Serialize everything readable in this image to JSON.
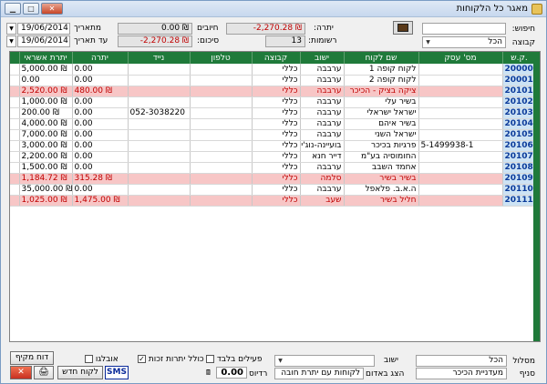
{
  "window": {
    "title": "מאגר כל הלקוחות",
    "minimize": "▁",
    "maximize": "□",
    "close": "✕"
  },
  "filters": {
    "search_label": "חיפוש:",
    "search_value": "",
    "group_label": "קבוצה",
    "group_value": "הכל",
    "balance_label": "יתרה:",
    "balance_value": "-2,270.28 ₪",
    "records_label": "רשומות:",
    "records_value": "13",
    "debits_label": "חיובים",
    "debits_value": "0.00 ₪",
    "total_label": "סיכום:",
    "total_value": "-2,270.28 ₪",
    "from_date_label": "מתאריך",
    "from_date_value": "19/06/2014",
    "to_date_label": "עד תאריך",
    "to_date_value": "19/06/2014"
  },
  "table": {
    "columns": [
      "ק.ש.",
      "מס' עסק",
      "שם לקוח",
      "ישוב",
      "קבוצה",
      "טלפון",
      "נייד",
      "יתרה",
      "יתרת אשראי"
    ],
    "rows": [
      {
        "code": "20000",
        "biz": "",
        "name": "לקוח קופה 1",
        "city": "ערבבה",
        "group": "כללי",
        "phone": "",
        "mobile": "",
        "balance": "0.00",
        "credit": "5,000.00 ₪",
        "debt": false
      },
      {
        "code": "20001",
        "biz": "",
        "name": "לקוח קופה 2",
        "city": "ערבבה",
        "group": "כללי",
        "phone": "",
        "mobile": "",
        "balance": "0.00",
        "credit": "0.00",
        "debt": false
      },
      {
        "code": "20101",
        "biz": "",
        "name": "ציקה בציק - הכיכר",
        "city": "ערבבה",
        "group": "כללי",
        "phone": "",
        "mobile": "",
        "balance": "480.00 ₪",
        "credit": "2,520.00 ₪",
        "debt": true
      },
      {
        "code": "20102",
        "biz": "",
        "name": "בשיר עלי",
        "city": "ערבבה",
        "group": "כללי",
        "phone": "",
        "mobile": "",
        "balance": "0.00",
        "credit": "1,000.00 ₪",
        "debt": false
      },
      {
        "code": "20103",
        "biz": "",
        "name": "ישראל ישראלי",
        "city": "ערבבה",
        "group": "כללי",
        "phone": "",
        "mobile": "052-3038220",
        "balance": "0.00",
        "credit": "200.00 ₪",
        "debt": false
      },
      {
        "code": "20104",
        "biz": "",
        "name": "בשיר איהם",
        "city": "ערבבה",
        "group": "כללי",
        "phone": "",
        "mobile": "",
        "balance": "0.00",
        "credit": "4,000.00 ₪",
        "debt": false
      },
      {
        "code": "20105",
        "biz": "",
        "name": "ישראל השני",
        "city": "ערבבה",
        "group": "כללי",
        "phone": "",
        "mobile": "",
        "balance": "0.00",
        "credit": "7,000.00 ₪",
        "debt": false
      },
      {
        "code": "20106",
        "biz": "5-1499938-1",
        "name": "פרגיות בכיכר",
        "city": "בועיינה-נוג'יד",
        "group": "כללי",
        "phone": "",
        "mobile": "",
        "balance": "0.00",
        "credit": "3,000.00 ₪",
        "debt": false
      },
      {
        "code": "20107",
        "biz": "",
        "name": "החומוסיה בע\"מ",
        "city": "דייר חנא",
        "group": "כללי",
        "phone": "",
        "mobile": "",
        "balance": "0.00",
        "credit": "2,200.00 ₪",
        "debt": false
      },
      {
        "code": "20108",
        "biz": "",
        "name": "אחמד השבב",
        "city": "ערבבה",
        "group": "כללי",
        "phone": "",
        "mobile": "",
        "balance": "0.00",
        "credit": "1,500.00 ₪",
        "debt": false
      },
      {
        "code": "20109",
        "biz": "",
        "name": "בשיר בשיר",
        "city": "סלמה",
        "group": "כללי",
        "phone": "",
        "mobile": "",
        "balance": "315.28 ₪",
        "credit": "1,184.72 ₪",
        "debt": true
      },
      {
        "code": "20110",
        "biz": "",
        "name": "ה.א.ב. פלאפל",
        "city": "ערבבה",
        "group": "כללי",
        "phone": "",
        "mobile": "",
        "balance": "0.00",
        "credit": "35,000.00 ₪",
        "debt": false
      },
      {
        "code": "20111",
        "biz": "",
        "name": "חליל בשיר",
        "city": "שעב",
        "group": "כללי",
        "phone": "",
        "mobile": "",
        "balance": "1,475.00 ₪",
        "credit": "1,025.00 ₪",
        "debt": true
      }
    ]
  },
  "bottom": {
    "filter_label": "מסלול",
    "filter_value": "הכל",
    "city_label": "ישוב",
    "city_value": "",
    "branch_label": "סניף",
    "branch_value": "מעדניית הכיכר",
    "show_label": "הצג באדום",
    "show_value": "לקוחות עם יתרת חובה",
    "active_only": "פעילים בלבד",
    "include_zero": "כולל יתרות זכות",
    "favorites": "אובלגו",
    "profit_label": "רדיוס",
    "profit_value": "0.00",
    "new_customer": "לקוח חדש",
    "sms": "SMS",
    "report": "דוח מקיף",
    "exit": "✕",
    "print": "🖨"
  }
}
